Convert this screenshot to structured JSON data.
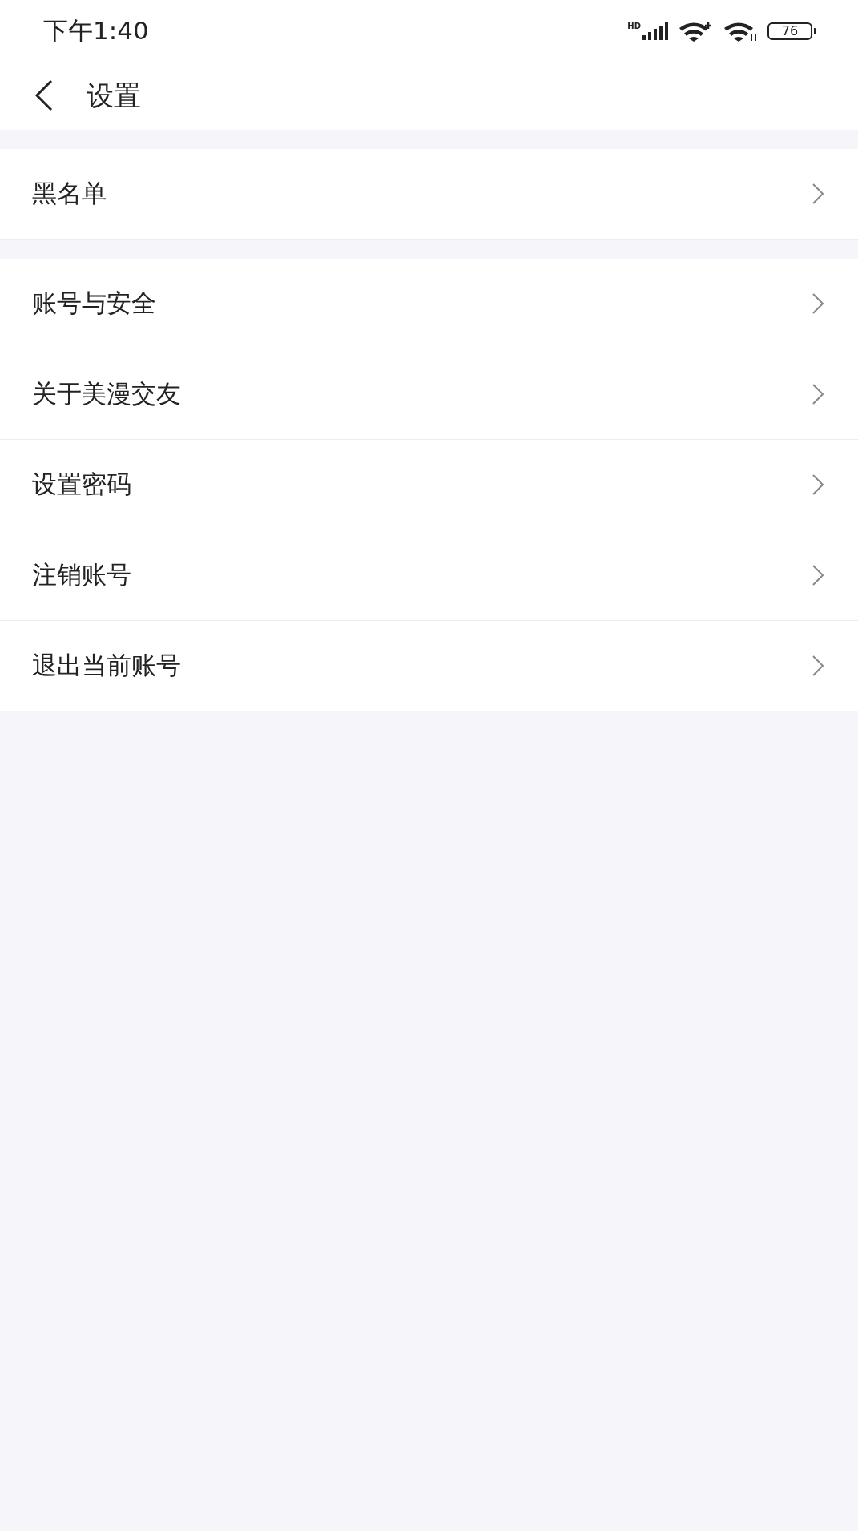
{
  "status_bar": {
    "time": "下午1:40",
    "signal_label": "HD",
    "battery": "76"
  },
  "header": {
    "title": "设置"
  },
  "sections": [
    {
      "items": [
        {
          "label": "黑名单"
        }
      ]
    },
    {
      "items": [
        {
          "label": "账号与安全"
        },
        {
          "label": "关于美漫交友"
        },
        {
          "label": "设置密码"
        },
        {
          "label": "注销账号"
        },
        {
          "label": "退出当前账号"
        }
      ]
    }
  ]
}
